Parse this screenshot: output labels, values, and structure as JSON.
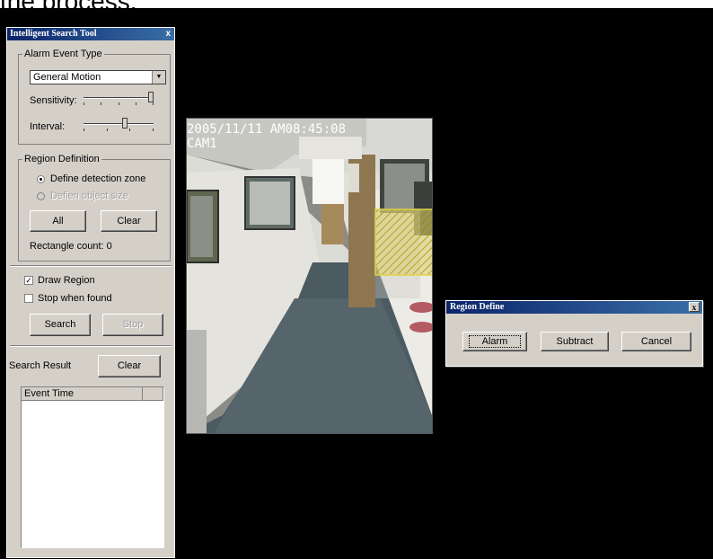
{
  "caption": "the process.",
  "tool": {
    "title": "Intelligent Search Tool",
    "close": "x",
    "alarm_event_type": {
      "legend": "Alarm Event Type",
      "selected": "General Motion",
      "sensitivity_label": "Sensitivity:",
      "interval_label": "Interval:",
      "sensitivity_value": 1.0,
      "interval_value": 0.6
    },
    "region_definition": {
      "legend": "Region Definition",
      "define_zone": "Define detection zone",
      "define_size": "Defien object size",
      "all_button": "All",
      "clear_button": "Clear",
      "rect_count": "Rectangle count: 0"
    },
    "draw_region": "Draw Region",
    "stop_when_found": "Stop when found",
    "search_button": "Search",
    "stop_button": "Stop",
    "search_result": "Search Result",
    "result_clear": "Clear",
    "list_header": "Event Time"
  },
  "video": {
    "timestamp": "2005/11/11 AM08:45:08",
    "camera": "CAM1"
  },
  "dialog": {
    "title": "Region Define",
    "close": "x",
    "alarm": "Alarm",
    "subtract": "Subtract",
    "cancel": "Cancel"
  }
}
